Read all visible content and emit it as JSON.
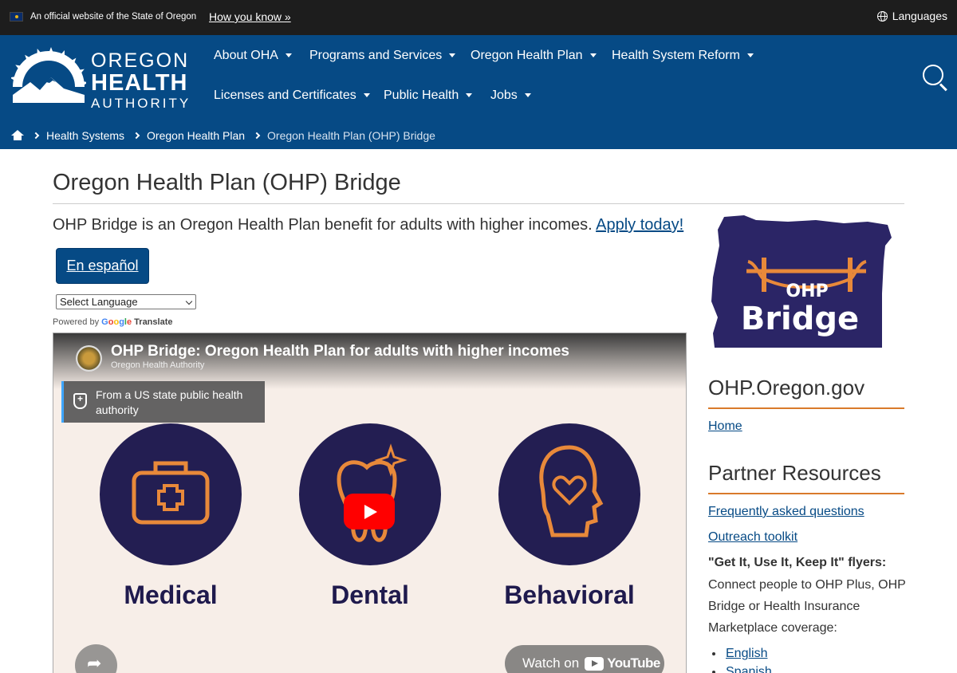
{
  "govbar": {
    "official_text": "An official website of the State of Oregon",
    "how_you_know": "How you know »",
    "languages": "Languages"
  },
  "logo": {
    "line1": "OREGON",
    "line2": "HEALTH",
    "line3": "AUTHORITY"
  },
  "nav": {
    "items": [
      {
        "label": "About OHA"
      },
      {
        "label": "Programs and Services"
      },
      {
        "label": "Oregon Health Plan"
      },
      {
        "label": "Health System Reform"
      },
      {
        "label": "Licenses and Certificates"
      },
      {
        "label": "Public Health"
      },
      {
        "label": "Jobs"
      }
    ]
  },
  "breadcrumb": {
    "items": [
      "Health Systems",
      "Oregon Health Plan"
    ],
    "current": "Oregon Health Plan (OHP) Bridge"
  },
  "main": {
    "title": "Oregon Health Plan (OHP) Bridge",
    "intro": "OHP Bridge is an Oregon Health Plan benefit for adults with higher incomes. ",
    "apply_link": "Apply today!",
    "espanol_button": "En español",
    "language_select": "Select Language",
    "powered_by": "Powered by",
    "google": "Google",
    "translate": "Translate"
  },
  "video": {
    "title": "OHP Bridge: Oregon Health Plan for adults with higher incomes",
    "channel": "Oregon Health Authority",
    "info_panel": "From a US state public health authority",
    "categories": [
      "Medical",
      "Dental",
      "Behavioral"
    ],
    "watch_on": "Watch on",
    "youtube": "YouTube"
  },
  "sidebar": {
    "logo_text_top": "OHP",
    "logo_text_bottom": "Bridge",
    "heading1": "OHP.Oregon.gov",
    "home_link": "Home",
    "heading2": "Partner Resources",
    "faq_link": "Frequently asked questions",
    "toolkit_link": "Outreach toolkit",
    "flyers_heading": "\"Get It, Use It, Keep It\" flyers:",
    "flyers_text": "Connect people to OHP Plus, OHP Bridge or Health Insurance Marketplace coverage:",
    "languages": [
      "English",
      "Spanish"
    ]
  },
  "colors": {
    "header_blue": "#064a85",
    "gov_bar": "#1d1d1d",
    "accent_orange": "#d97a2b",
    "ohp_purple": "#231e52"
  }
}
